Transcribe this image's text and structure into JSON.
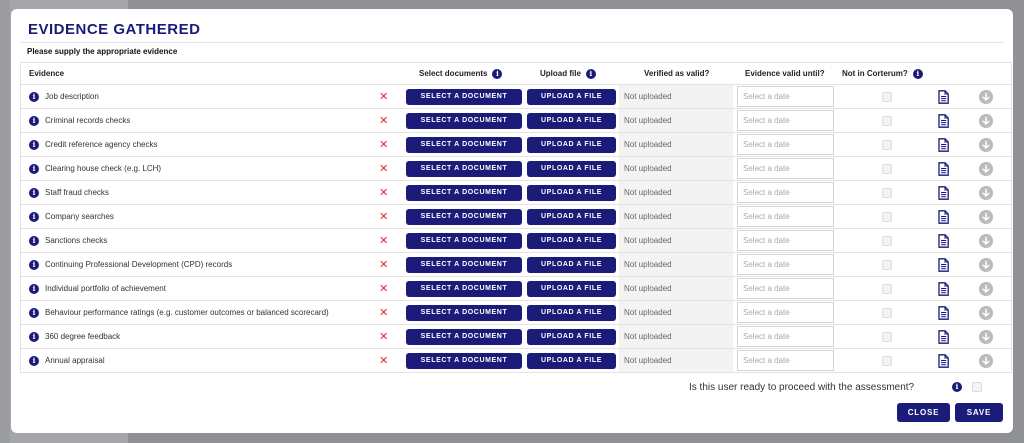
{
  "modal": {
    "title": "EVIDENCE GATHERED",
    "subtitle": "Please supply the appropriate evidence"
  },
  "table": {
    "headers": {
      "evidence": "Evidence",
      "select_documents": "Select documents",
      "upload_file": "Upload file",
      "verified": "Verified as valid?",
      "valid_until": "Evidence valid until?",
      "not_in_corterum": "Not in Corterum?"
    },
    "rows": [
      {
        "label": "Job description",
        "select": "SELECT A DOCUMENT",
        "upload": "UPLOAD A FILE",
        "status": "Not uploaded",
        "date_placeholder": "Select a date"
      },
      {
        "label": "Criminal records checks",
        "select": "SELECT A DOCUMENT",
        "upload": "UPLOAD A FILE",
        "status": "Not uploaded",
        "date_placeholder": "Select a date"
      },
      {
        "label": "Credit reference agency checks",
        "select": "SELECT A DOCUMENT",
        "upload": "UPLOAD A FILE",
        "status": "Not uploaded",
        "date_placeholder": "Select a date"
      },
      {
        "label": "Clearing house check (e.g. LCH)",
        "select": "SELECT A DOCUMENT",
        "upload": "UPLOAD A FILE",
        "status": "Not uploaded",
        "date_placeholder": "Select a date"
      },
      {
        "label": "Staff fraud checks",
        "select": "SELECT A DOCUMENT",
        "upload": "UPLOAD A FILE",
        "status": "Not uploaded",
        "date_placeholder": "Select a date"
      },
      {
        "label": "Company searches",
        "select": "SELECT A DOCUMENT",
        "upload": "UPLOAD A FILE",
        "status": "Not uploaded",
        "date_placeholder": "Select a date"
      },
      {
        "label": "Sanctions checks",
        "select": "SELECT A DOCUMENT",
        "upload": "UPLOAD A FILE",
        "status": "Not uploaded",
        "date_placeholder": "Select a date"
      },
      {
        "label": "Continuing Professional Development (CPD) records",
        "select": "SELECT A DOCUMENT",
        "upload": "UPLOAD A FILE",
        "status": "Not uploaded",
        "date_placeholder": "Select a date"
      },
      {
        "label": "Individual portfolio of achievement",
        "select": "SELECT A DOCUMENT",
        "upload": "UPLOAD A FILE",
        "status": "Not uploaded",
        "date_placeholder": "Select a date"
      },
      {
        "label": "Behaviour performance ratings (e.g. customer outcomes or balanced scorecard)",
        "select": "SELECT A DOCUMENT",
        "upload": "UPLOAD A FILE",
        "status": "Not uploaded",
        "date_placeholder": "Select a date"
      },
      {
        "label": "360 degree feedback",
        "select": "SELECT A DOCUMENT",
        "upload": "UPLOAD A FILE",
        "status": "Not uploaded",
        "date_placeholder": "Select a date"
      },
      {
        "label": "Annual appraisal",
        "select": "SELECT A DOCUMENT",
        "upload": "UPLOAD A FILE",
        "status": "Not uploaded",
        "date_placeholder": "Select a date"
      }
    ]
  },
  "footer": {
    "question": "Is this user ready to proceed with the assessment?",
    "close_label": "CLOSE",
    "save_label": "SAVE"
  },
  "icons": {
    "info": "info-icon",
    "remove": "close-icon",
    "document": "document-icon",
    "download": "download-icon"
  },
  "colors": {
    "primary": "#1b1c7a",
    "remove": "#e0302a",
    "download": "#b9bbbe",
    "overlay": "#8f9195"
  }
}
